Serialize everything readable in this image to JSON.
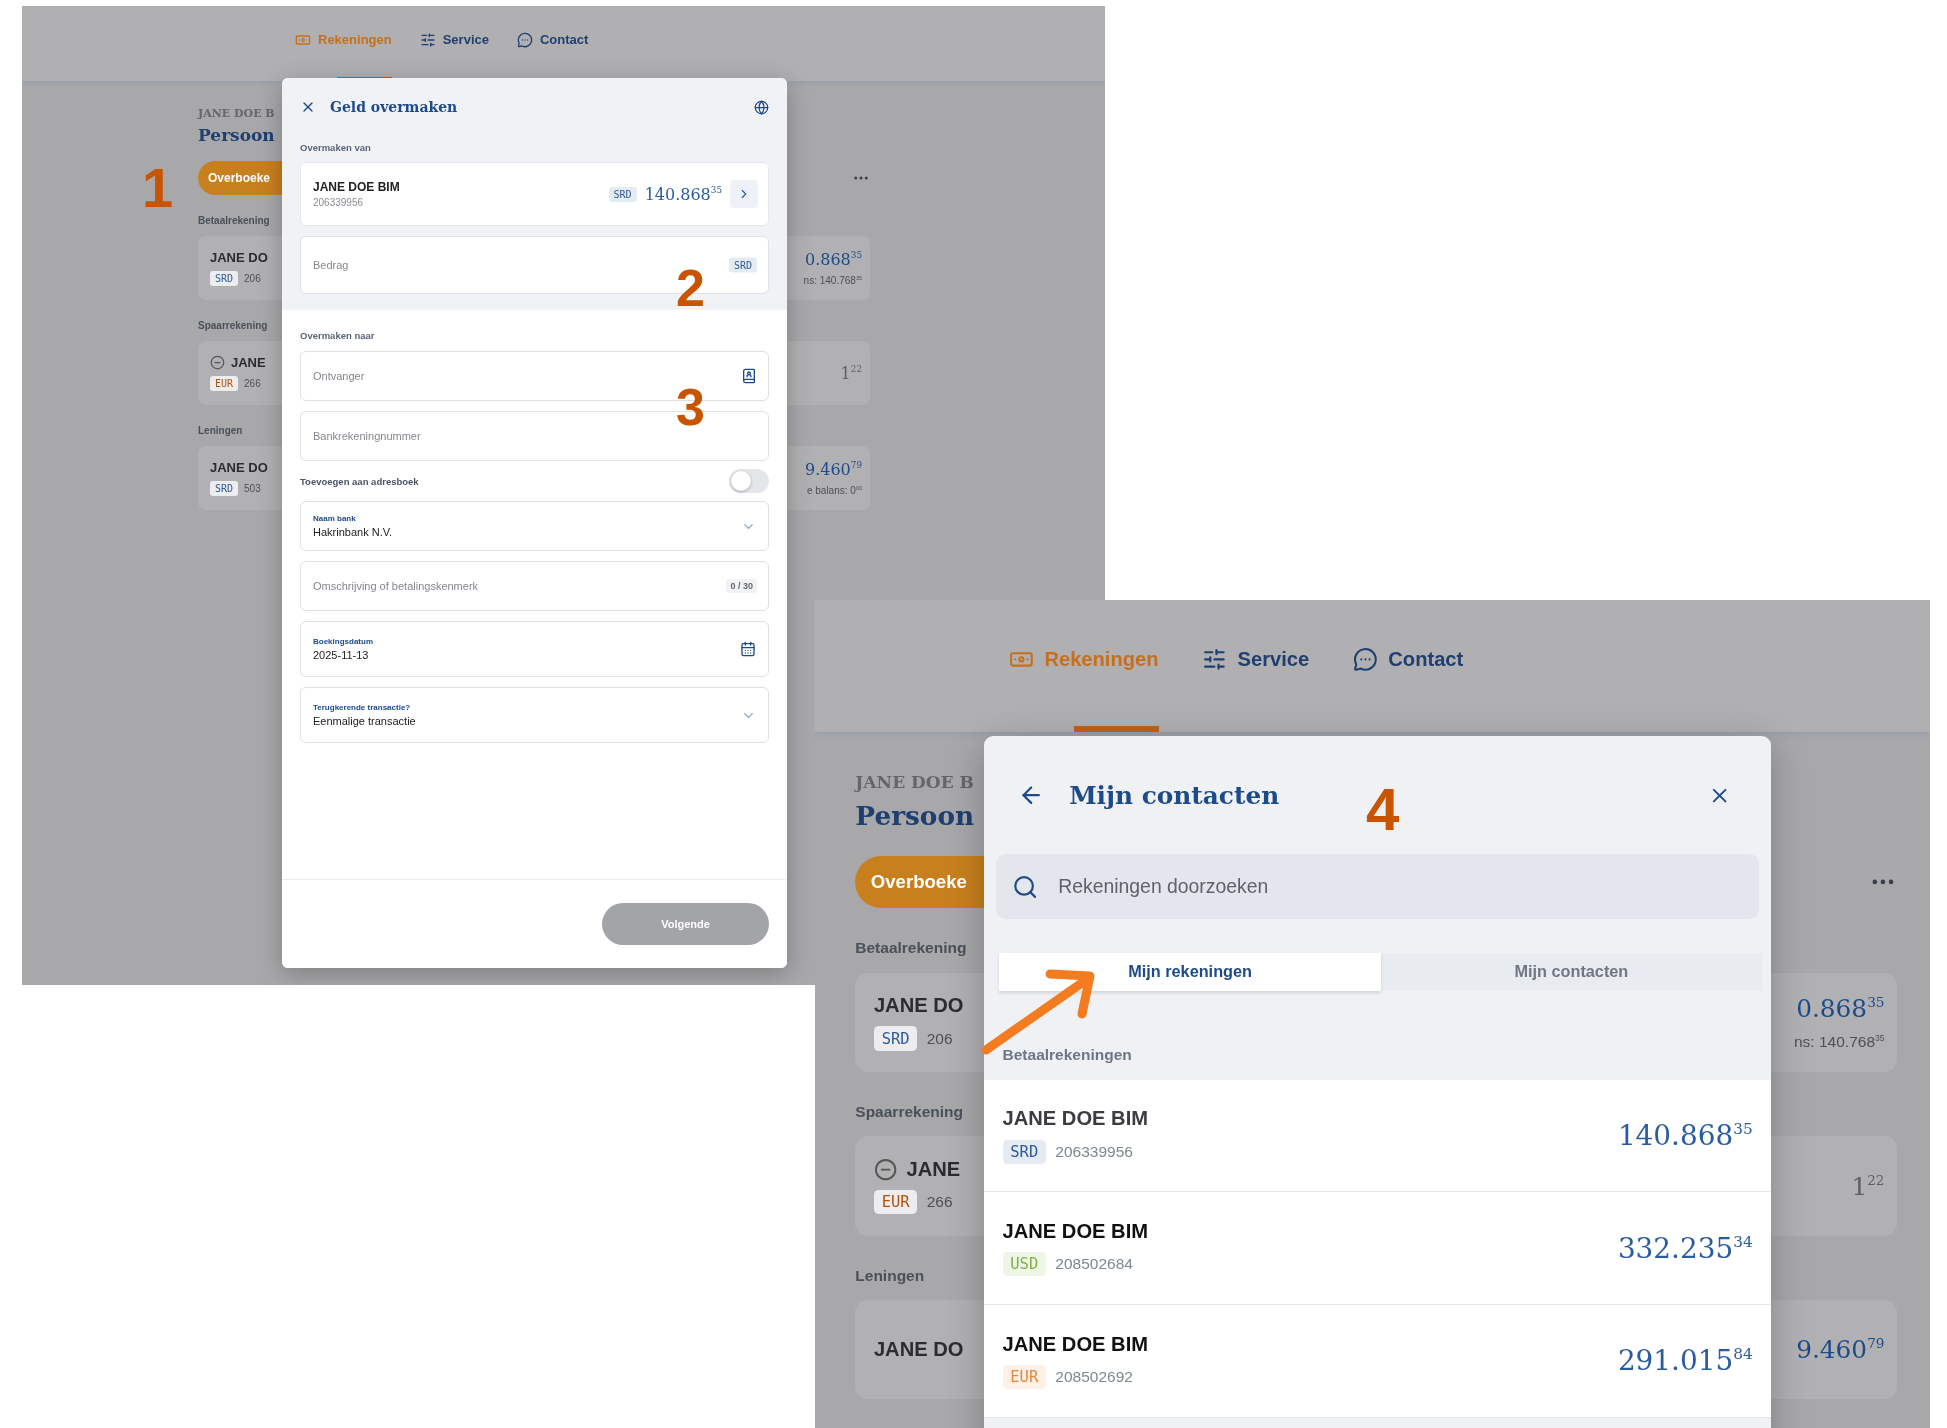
{
  "annotations": [
    "1",
    "2",
    "3",
    "4"
  ],
  "screens": [
    {
      "nav": [
        {
          "label": "Rekeningen",
          "selected": true
        },
        {
          "label": "Service",
          "selected": false
        },
        {
          "label": "Contact",
          "selected": false
        }
      ],
      "page": {
        "owner": "JANE DOE B",
        "title": "Persoon",
        "action": "Overboeke",
        "sections": [
          {
            "heading": "Betaalrekening",
            "accounts": [
              {
                "kind": "payment",
                "name": "JANE DO",
                "currency": "SRD",
                "color": "#2d5a9a",
                "number": "206",
                "amount": "0.868$^{35}$",
                "note": "ns: 140.768$^{35}$"
              }
            ]
          },
          {
            "heading": "Spaarrekening",
            "accounts": [
              {
                "kind": "savings",
                "name": "JANE",
                "currency": "EUR",
                "color": "#b0530e",
                "number": "266",
                "amount": "1$^{22}$"
              }
            ]
          },
          {
            "heading": "Leningen",
            "accounts": [
              {
                "kind": "loan",
                "name": "JANE DO",
                "currency": "SRD",
                "color": "#2d5a9a",
                "number": "503",
                "amount": "9.460$^{79}$",
                "note": "e balans: 0$^{00}$"
              }
            ]
          }
        ]
      }
    },
    {
      "nav": [
        {
          "label": "Rekeningen",
          "selected": true
        },
        {
          "label": "Service",
          "selected": false
        },
        {
          "label": "Contact",
          "selected": false
        }
      ],
      "page": {
        "owner": "JANE DOE B",
        "title": "Persoon",
        "action": "Overboeke",
        "sections": [
          {
            "heading": "Betaalrekening",
            "accounts": [
              {
                "kind": "payment",
                "name": "JANE DO",
                "currency": "SRD",
                "color": "#2d5a9a",
                "number": "206",
                "amount": "0.868$^{35}$",
                "note": "ns: 140.768$^{35}$"
              }
            ]
          },
          {
            "heading": "Spaarrekening",
            "accounts": [
              {
                "kind": "savings",
                "name": "JANE",
                "currency": "EUR",
                "color": "#b0530e",
                "number": "266",
                "amount": "1$^{22}$"
              }
            ]
          },
          {
            "heading": "Leningen",
            "accounts": [
              {
                "kind": "loan",
                "name": "JANE DO",
                "amount": "9.460$^{79}$"
              }
            ]
          }
        ]
      }
    }
  ],
  "transfer_dialog": {
    "title": "Geld overmaken",
    "from_label": "Overmaken van",
    "from": {
      "name": "JANE DOE BIM",
      "number": "206339956",
      "currency": "SRD",
      "amount": "140.868$^{35}$"
    },
    "amount_field": {
      "placeholder": "Bedrag",
      "currency": "SRD"
    },
    "to_label": "Overmaken naar",
    "fields": [
      {
        "kind": "contact",
        "placeholder": "Ontvanger"
      },
      {
        "kind": "text",
        "placeholder": "Bankrekeningnummer"
      },
      {
        "kind": "toggle",
        "label": "Toevoegen aan adresboek",
        "on": false
      },
      {
        "kind": "select",
        "label": "Naam bank",
        "value": "Hakrinbank N.V."
      },
      {
        "kind": "counter",
        "placeholder": "Omschrijving of betalingskenmerk",
        "counter": "0 / 30"
      },
      {
        "kind": "date",
        "label": "Boekingsdatum",
        "value": "2025-11-13"
      },
      {
        "kind": "select",
        "label": "Terugkerende transactie?",
        "value": "Eenmalige transactie"
      }
    ],
    "submit": {
      "label": "Volgende",
      "disabled": true
    }
  },
  "contacts_dialog": {
    "title": "Mijn contacten",
    "search": {
      "placeholder": "Rekeningen doorzoeken"
    },
    "tabs": [
      {
        "label": "Mijn rekeningen",
        "selected": true
      },
      {
        "label": "Mijn contacten",
        "selected": false
      }
    ],
    "section": "Betaalrekeningen",
    "accounts": [
      {
        "name": "JANE DOE BIM",
        "currency": "SRD",
        "color": "#2d5a9a",
        "number": "206339956",
        "amount": "140.868$^{35}$"
      },
      {
        "name": "JANE DOE BIM",
        "currency": "USD",
        "color": "#7cb342",
        "number": "208502684",
        "amount": "332.235$^{34}$"
      },
      {
        "name": "JANE DOE BIM",
        "currency": "EUR",
        "color": "#e8873a",
        "number": "208502692",
        "amount": "291.015$^{84}$"
      }
    ]
  }
}
